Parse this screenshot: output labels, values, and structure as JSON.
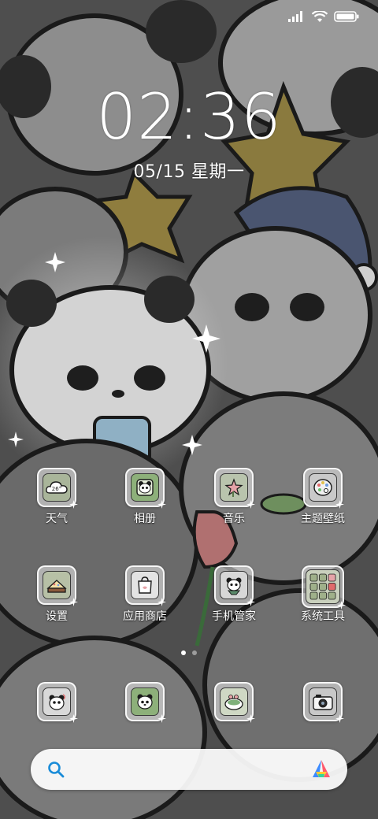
{
  "status_bar": {
    "signal_icon": "signal-bars-icon",
    "wifi_icon": "wifi-icon",
    "battery_icon": "battery-icon"
  },
  "lockscreen": {
    "time": "02:36",
    "date": "05/15 星期一"
  },
  "apps": [
    {
      "label": "天气",
      "icon": "weather-cloud-icon",
      "badge_text": "26°"
    },
    {
      "label": "相册",
      "icon": "gallery-panda-icon"
    },
    {
      "label": "音乐",
      "icon": "music-star-icon"
    },
    {
      "label": "主题壁纸",
      "icon": "theme-palette-icon"
    },
    {
      "label": "设置",
      "icon": "settings-cake-icon"
    },
    {
      "label": "应用商店",
      "icon": "app-store-bag-icon"
    },
    {
      "label": "手机管家",
      "icon": "phone-manager-panda-icon"
    },
    {
      "label": "系统工具",
      "icon": "system-tools-folder-icon"
    }
  ],
  "dock": [
    {
      "icon": "phone-panda-icon"
    },
    {
      "icon": "messages-panda-icon"
    },
    {
      "icon": "browser-cup-icon"
    },
    {
      "icon": "camera-icon"
    }
  ],
  "page_indicator": {
    "pages": 2,
    "current": 1
  },
  "search_bar": {
    "search_icon": "search-icon",
    "assistant_icon": "assistant-logo-icon",
    "accent": "#1a8cd8"
  }
}
